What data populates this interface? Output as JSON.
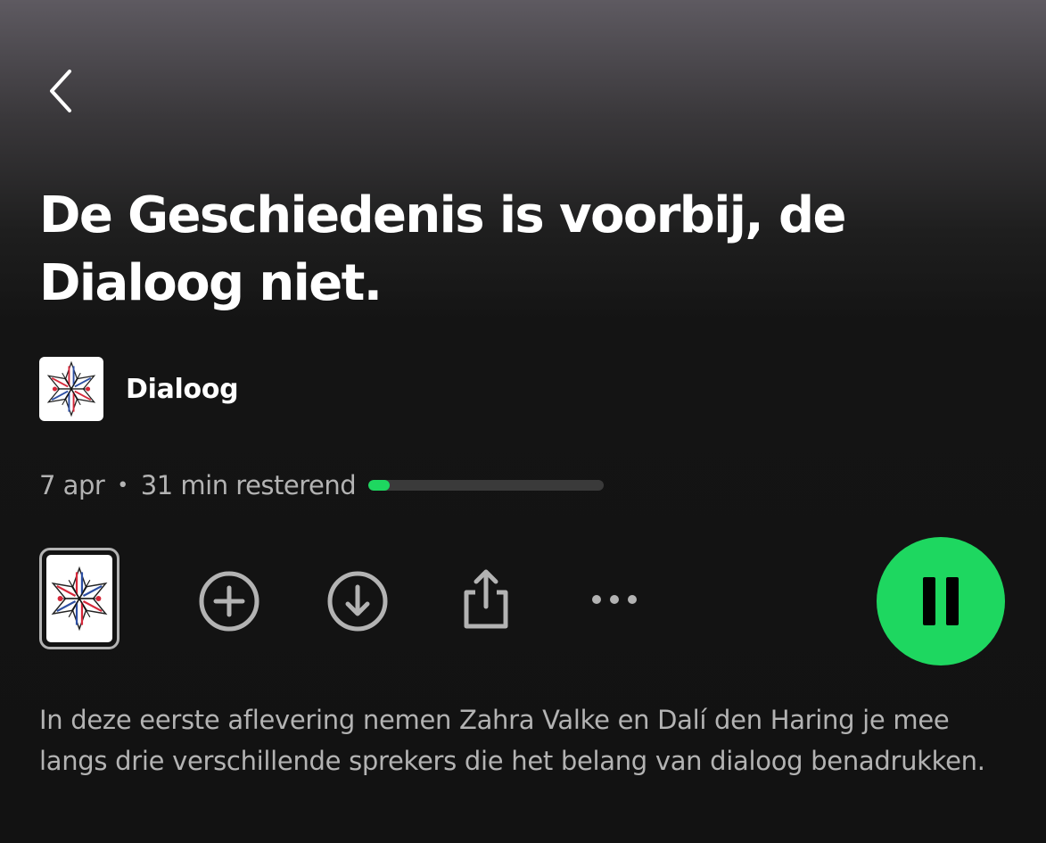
{
  "episode": {
    "title": "De Geschiedenis is voorbij, de Dialoog niet.",
    "description": "In deze eerste aflevering nemen Zahra Valke en Dalí den Haring je mee langs drie verschillende sprekers die het belang van dialoog benadrukken."
  },
  "podcast": {
    "name": "Dialoog"
  },
  "meta": {
    "date": "7 apr",
    "separator": "•",
    "remaining": "31 min resterend",
    "progress_percent": 9
  },
  "icons": {
    "back": "chevron-left-icon",
    "add": "plus-circle-icon",
    "download": "download-circle-icon",
    "share": "share-icon",
    "more": "more-horizontal-icon",
    "pause": "pause-icon"
  },
  "colors": {
    "accent": "#1ed760",
    "text_secondary": "#b3b3b3",
    "background": "#121212"
  }
}
